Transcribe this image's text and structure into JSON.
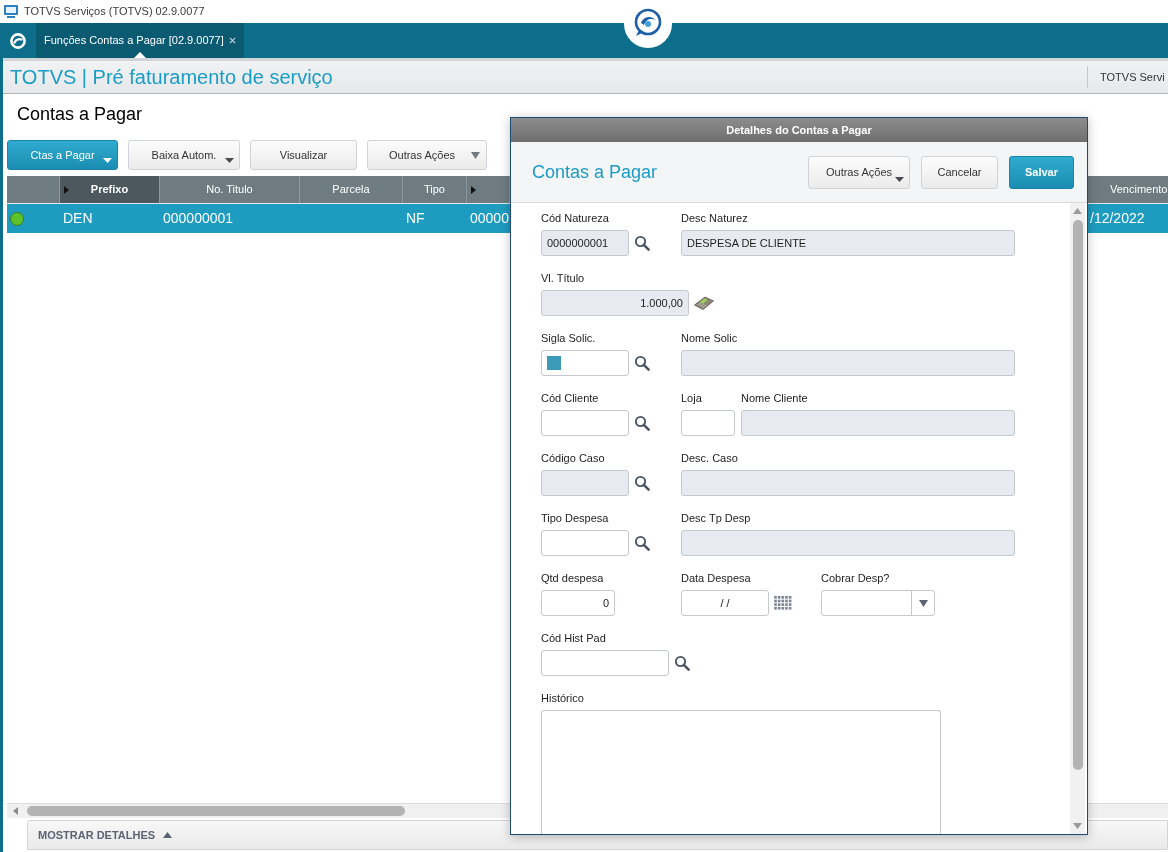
{
  "window": {
    "title": "TOTVS Serviços (TOTVS) 02.9.0077"
  },
  "tabs": [
    {
      "label": "Funções Contas a Pagar [02.9.0077]",
      "selected": true
    }
  ],
  "header": {
    "title": "TOTVS | Pré faturamento de serviço",
    "right_text": "TOTVS Servi"
  },
  "page": {
    "title": "Contas a Pagar"
  },
  "toolbar": [
    {
      "label": "Ctas a Pagar",
      "kind": "split",
      "primary": true
    },
    {
      "label": "Baixa Autom.",
      "kind": "split",
      "primary": false
    },
    {
      "label": "Visualizar",
      "kind": "plain",
      "primary": false
    },
    {
      "label": "Outras Ações",
      "kind": "menu",
      "primary": false
    }
  ],
  "table": {
    "columns": [
      {
        "label": "Prefixo",
        "active": true,
        "arrow": true
      },
      {
        "label": "No. Titulo",
        "active": false,
        "arrow": false
      },
      {
        "label": "Parcela",
        "active": false,
        "arrow": false
      },
      {
        "label": "Tipo",
        "active": false,
        "arrow": false
      },
      {
        "active": false,
        "arrow": true
      },
      {
        "label": "Vencimento",
        "active": false,
        "arrow": false
      }
    ],
    "rows": [
      {
        "selected": true,
        "color": "#5cc22c",
        "prefixo": "DEN",
        "no_titulo": "000000001",
        "tipo": "NF",
        "column_6": "00000",
        "vencimento": "/12/2022"
      }
    ]
  },
  "details_bar": {
    "label": "MOSTRAR DETALHES"
  },
  "dialog": {
    "title": "Detalhes do Contas a Pagar",
    "heading": "Contas a Pagar",
    "buttons": [
      {
        "label": "Outras Ações",
        "kind": "split",
        "primary": false
      },
      {
        "label": "Cancelar",
        "kind": "plain",
        "primary": false
      },
      {
        "label": "Salvar",
        "kind": "plain",
        "primary": true
      }
    ],
    "rows": [
      [
        {
          "label": "Cód Natureza",
          "kind": "lookup",
          "value": "0000000001",
          "disabled": true,
          "focused": false
        },
        {
          "label": "Desc Naturez",
          "kind": "text",
          "value": "DESPESA DE CLIENTE",
          "disabled": true,
          "focused": false
        }
      ],
      [
        {
          "label": "Vl. Título",
          "kind": "money",
          "value": "1.000,00",
          "disabled": true,
          "focused": false
        }
      ],
      [
        {
          "label": "Sigla Solic.",
          "kind": "lookup",
          "disabled": false,
          "focused": true
        },
        {
          "label": "Nome Solic",
          "kind": "text",
          "disabled": true,
          "focused": false
        }
      ],
      [
        {
          "label": "Cód Cliente",
          "kind": "lookup",
          "disabled": false,
          "focused": false
        },
        {
          "label": "Loja",
          "kind": "text",
          "disabled": false,
          "focused": false
        },
        {
          "label": "Nome Cliente",
          "kind": "text",
          "disabled": true,
          "focused": false
        }
      ],
      [
        {
          "label": "Código Caso",
          "kind": "lookup",
          "disabled": true,
          "focused": false
        },
        {
          "label": "Desc. Caso",
          "kind": "text",
          "disabled": true,
          "focused": false
        }
      ],
      [
        {
          "label": "Tipo Despesa",
          "kind": "lookup",
          "disabled": false,
          "focused": false
        },
        {
          "label": "Desc Tp Desp",
          "kind": "text",
          "disabled": true,
          "focused": false
        }
      ],
      [
        {
          "label": "Qtd despesa",
          "kind": "number",
          "value": "0",
          "disabled": false,
          "focused": false
        },
        {
          "label": "Data Despesa",
          "kind": "date",
          "value": "/ /",
          "disabled": false,
          "focused": false
        },
        {
          "label": "Cobrar Desp?",
          "kind": "select",
          "disabled": false,
          "focused": false
        }
      ],
      [
        {
          "label": "Cód Hist Pad",
          "kind": "lookup",
          "disabled": false,
          "focused": false
        }
      ],
      [
        {
          "label": "Histórico",
          "kind": "textarea",
          "disabled": false,
          "focused": false
        }
      ]
    ]
  }
}
